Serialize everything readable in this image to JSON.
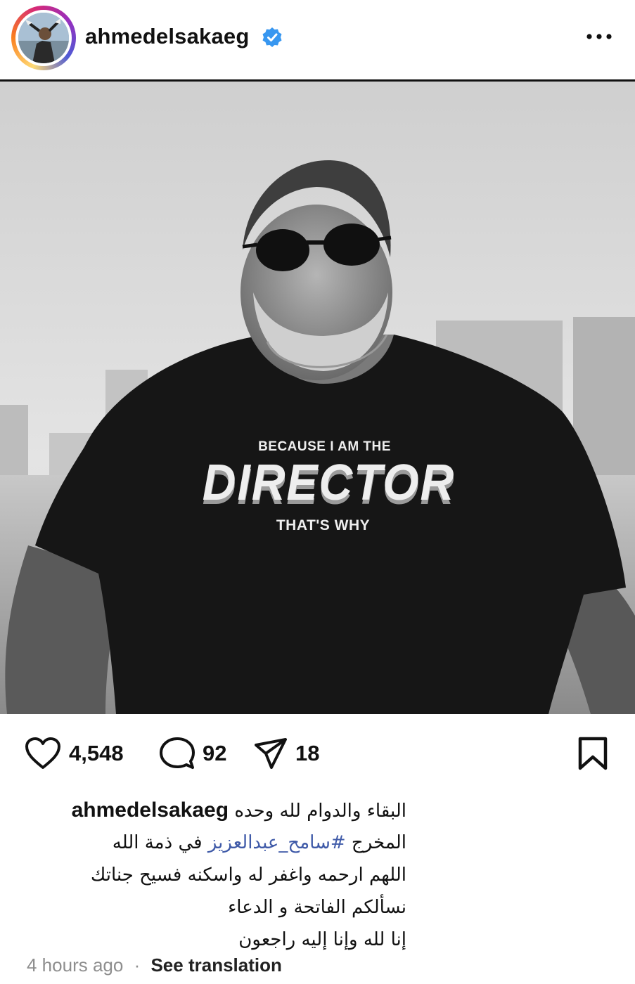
{
  "post": {
    "username": "ahmedelsakaeg",
    "verified": true,
    "icons": {
      "verified": "verified-badge-icon",
      "more": "more-options-icon",
      "like": "heart-icon",
      "comment": "comment-icon",
      "share": "send-icon",
      "save": "bookmark-icon"
    }
  },
  "photo": {
    "shirt_line1": "BECAUSE I AM THE",
    "shirt_line2": "DIRECTOR",
    "shirt_line3": "THAT'S WHY"
  },
  "stats": {
    "likes": "4,548",
    "comments": "92",
    "shares": "18"
  },
  "caption": {
    "username": "ahmedelsakaeg",
    "line1": "البقاء والدوام لله وحده",
    "line2_prefix": "المخرج",
    "line2_hashtag": "#سامح_عبدالعزيز",
    "line2_suffix": "في ذمة الله",
    "line3": "اللهم ارحمه واغفر له واسكنه فسيح جناتك",
    "line4": "نسألكم الفاتحة و الدعاء",
    "line5": "إنا لله وإنا إليه راجعون"
  },
  "meta": {
    "time": "4 hours ago",
    "separator": "·",
    "translate": "See translation"
  },
  "colors": {
    "hashtag": "#3f5aa8",
    "verified": "#3897f0",
    "muted": "#8e8e8e"
  }
}
